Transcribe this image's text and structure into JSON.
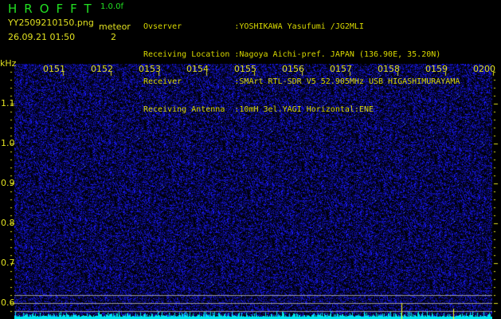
{
  "header": {
    "brand": "HROFFT",
    "version": "1.0.0f",
    "filename": "YY2509210150.png",
    "datetime": "26.09.21 01:50",
    "meteor_label": "meteor",
    "meteor_count": "2"
  },
  "info": [
    {
      "label": "Ovserver           ",
      "value": ":YOSHIKAWA Yasufumi /JG2MLI"
    },
    {
      "label": "Receiving Location ",
      "value": ":Nagoya Aichi-pref. JAPAN (136.90E, 35.20N)"
    },
    {
      "label": "Receiver           ",
      "value": ":SMArt RTL-SDR V5 52.905MHz USB HIGASHIMURAYAMA"
    },
    {
      "label": "Receiving Antenna  ",
      "value": ":10mH 3el.YAGI Horizontal:ENE"
    }
  ],
  "axis": {
    "y_unit": "kHz",
    "y_ticks": [
      "1.1",
      "1.0",
      "0.9",
      "0.8",
      "0.7",
      "0.6"
    ],
    "x_ticks": [
      "0151",
      "0152",
      "0153",
      "0154",
      "0155",
      "0156",
      "0157",
      "0158",
      "0159",
      "0200"
    ]
  },
  "colors": {
    "background": "#000000",
    "noise": "#1a1acc",
    "spectrum": "#00e5ee",
    "text": "#e0e020",
    "meteor_marker": "#ffff00"
  }
}
